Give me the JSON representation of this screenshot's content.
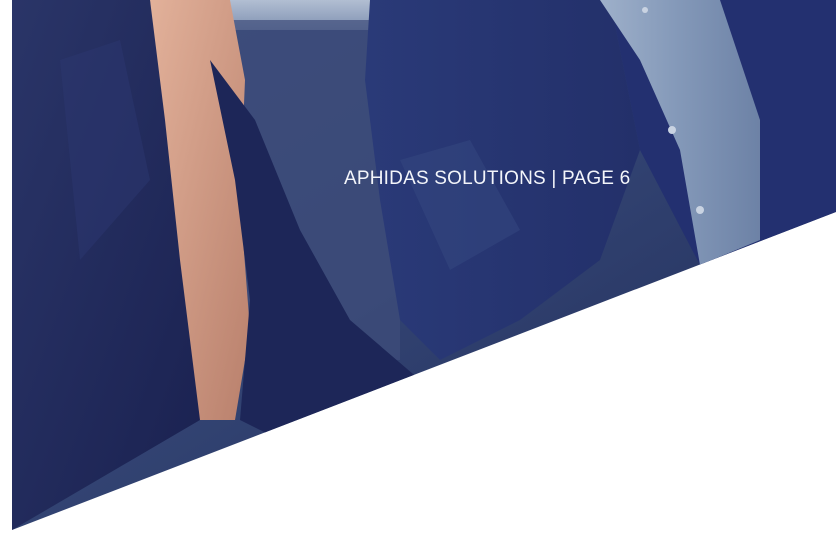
{
  "page": {
    "footer_label": "APHIDAS SOLUTIONS | PAGE 6"
  },
  "colors": {
    "background": "#ffffff",
    "photo_dark_navy": "#1c2553",
    "photo_mid_navy": "#2e3f78",
    "shirt_blue": "#7f93b4",
    "skin_tone": "#d9a38c",
    "text": "#f3f5fa"
  }
}
